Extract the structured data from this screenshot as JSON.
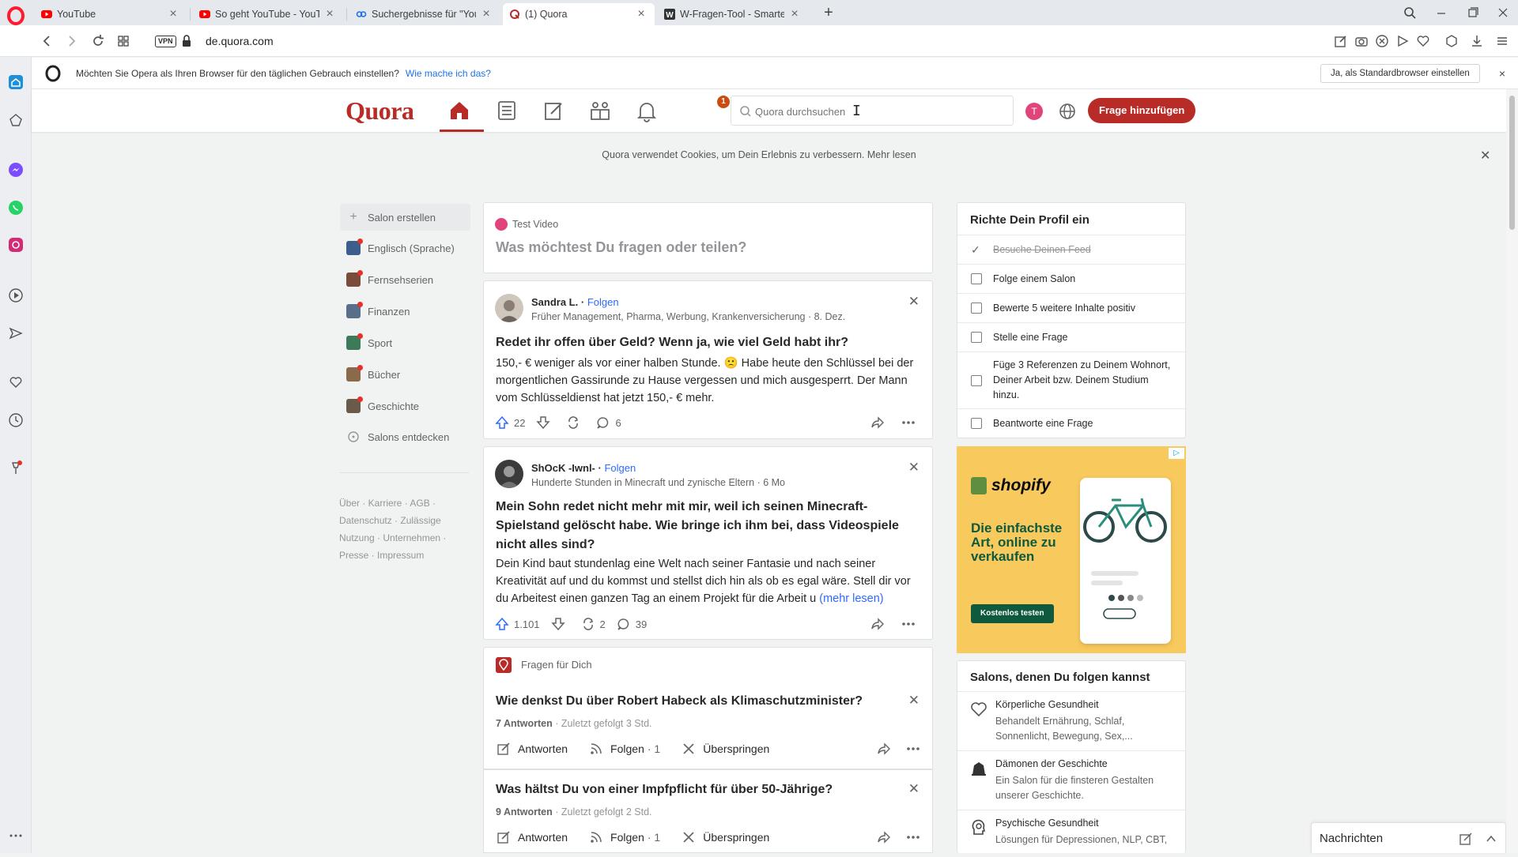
{
  "browser": {
    "tabs": [
      {
        "title": "YouTube",
        "icon": "youtube-icon",
        "color": "#ff0000"
      },
      {
        "title": "So geht YouTube - YouTu",
        "icon": "youtube-icon",
        "color": "#ff0000"
      },
      {
        "title": "Suchergebnisse für \"Youtu",
        "icon": "link-icon",
        "color": "#1a73e8"
      },
      {
        "title": "(1) Quora",
        "icon": "quora-icon",
        "color": "#b92b27",
        "active": true
      },
      {
        "title": "W-Fragen-Tool - Smarte ic",
        "icon": "w-icon",
        "color": "#333333"
      }
    ],
    "url": "de.quora.com",
    "vpn_label": "VPN",
    "infobar": {
      "message": "Möchten Sie Opera als Ihren Browser für den täglichen Gebrauch einstellen?",
      "link": "Wie mache ich das?",
      "button": "Ja, als Standardbrowser einstellen"
    }
  },
  "quora": {
    "logo": "Quora",
    "notification_count": "1",
    "search_placeholder": "Quora durchsuchen",
    "avatar_letter": "T",
    "ask_button": "Frage hinzufügen",
    "cookie_text": "Quora verwendet Cookies, um Dein Erlebnis zu verbessern.",
    "cookie_link": "Mehr lesen",
    "left_nav": [
      {
        "label": "Salon erstellen",
        "color": "#e9eaeb"
      },
      {
        "label": "Englisch (Sprache)",
        "color": "#3b5e8c"
      },
      {
        "label": "Fernsehserien",
        "color": "#7a4a3a"
      },
      {
        "label": "Finanzen",
        "color": "#5a6e8c"
      },
      {
        "label": "Sport",
        "color": "#3d7a5a"
      },
      {
        "label": "Bücher",
        "color": "#8a6a4a"
      },
      {
        "label": "Geschichte",
        "color": "#6a5a4a"
      },
      {
        "label": "Salons entdecken",
        "color": "#e9eaeb"
      }
    ],
    "footer": "Über · Karriere · AGB · Datenschutz · Zulässige Nutzung · Unternehmen · Presse · Impressum",
    "composer": {
      "user": "Test Video",
      "prompt": "Was möchtest Du fragen oder teilen?"
    },
    "posts": [
      {
        "author": "Sandra L.",
        "follow": "Folgen",
        "credential": "Früher Management, Pharma, Werbung, Krankenversicherung · 8. Dez.",
        "title": "Redet ihr offen über Geld? Wenn ja, wie viel Geld habt ihr?",
        "body": "150,- € weniger als vor einer halben Stunde. 🙁 Habe heute den Schlüssel bei der morgentlichen Gassirunde zu Hause vergessen und mich ausgesperrt. Der Mann vom Schlüsseldienst hat jetzt 150,- € mehr.",
        "upvotes": "22",
        "shares": "",
        "comments": "6"
      },
      {
        "author": "ShOcK -Iwnl-",
        "follow": "Folgen",
        "credential": "Hunderte Stunden in Minecraft und zynische Eltern · 6 Mo",
        "title": "Mein Sohn redet nicht mehr mit mir, weil ich seinen Minecraft-Spielstand gelöscht habe. Wie bringe ich ihm bei, dass Videospiele nicht alles sind?",
        "body": "Dein Kind baut stundenlag eine Welt nach seiner Fantasie und nach seiner Kreativität auf und du kommst und stellst dich hin als ob es egal wäre. Stell dir vor du Arbeitest einen ganzen Tag an einem Projekt für die Arbeit u",
        "more": "(mehr lesen)",
        "upvotes": "1.101",
        "shares": "2",
        "comments": "39"
      }
    ],
    "questions_header": "Fragen für Dich",
    "questions": [
      {
        "title": "Wie denkst Du über Robert Habeck als Klimaschutzminister?",
        "answers": "7 Antworten",
        "last": "Zuletzt gefolgt 3 Std.",
        "answer_label": "Antworten",
        "follow_label": "Folgen",
        "follow_count": "1",
        "skip_label": "Überspringen"
      },
      {
        "title": "Was hältst Du von einer Impfpflicht für über 50-Jährige?",
        "answers": "9 Antworten",
        "last": "Zuletzt gefolgt 2 Std.",
        "answer_label": "Antworten",
        "follow_label": "Folgen",
        "follow_count": "1",
        "skip_label": "Überspringen"
      }
    ],
    "profile_card": {
      "title": "Richte Dein Profil ein",
      "items": [
        {
          "label": "Besuche Deinen Feed",
          "done": true
        },
        {
          "label": "Folge einem Salon",
          "done": false
        },
        {
          "label": "Bewerte 5 weitere Inhalte positiv",
          "done": false
        },
        {
          "label": "Stelle eine Frage",
          "done": false
        },
        {
          "label": "Füge 3 Referenzen zu Deinem Wohnort, Deiner Arbeit bzw. Deinem Studium hinzu.",
          "done": false
        },
        {
          "label": "Beantworte eine Frage",
          "done": false
        }
      ]
    },
    "ad": {
      "brand": "shopify",
      "headline": "Die einfachste Art, online zu verkaufen",
      "cta": "Kostenlos testen"
    },
    "salons_card": {
      "title": "Salons, denen Du folgen kannst",
      "items": [
        {
          "name": "Körperliche Gesundheit",
          "desc": "Behandelt Ernährung, Schlaf, Sonnenlicht, Bewegung, Sex,..."
        },
        {
          "name": "Dämonen der Geschichte",
          "desc": "Ein Salon für die finsteren Gestalten unserer Geschichte."
        },
        {
          "name": "Psychische Gesundheit",
          "desc": "Lösungen für Depressionen, NLP, CBT,"
        }
      ]
    },
    "chat_label": "Nachrichten"
  }
}
